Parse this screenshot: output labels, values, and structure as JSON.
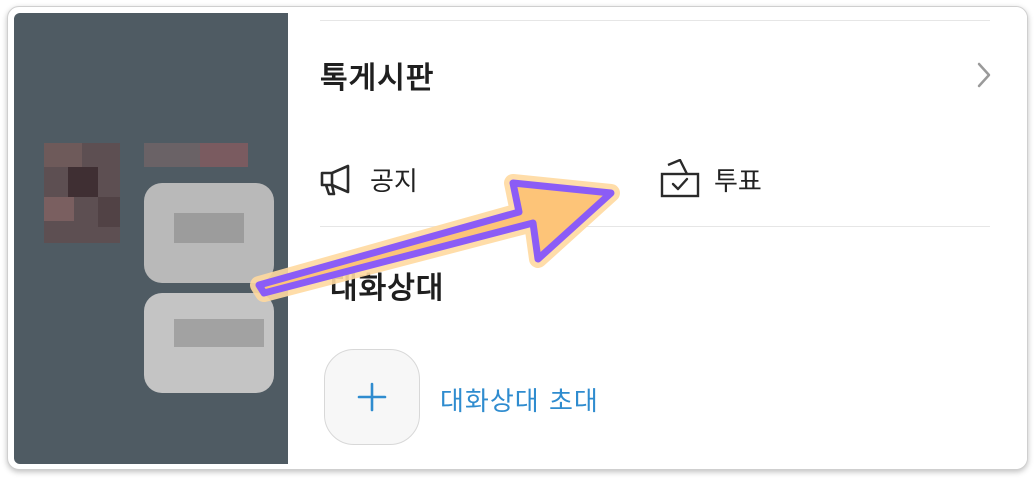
{
  "board": {
    "title": "톡게시판"
  },
  "menu": {
    "notice_label": "공지",
    "vote_label": "투표"
  },
  "participants": {
    "title": "대화상대",
    "invite_label": "대화상대 초대"
  }
}
